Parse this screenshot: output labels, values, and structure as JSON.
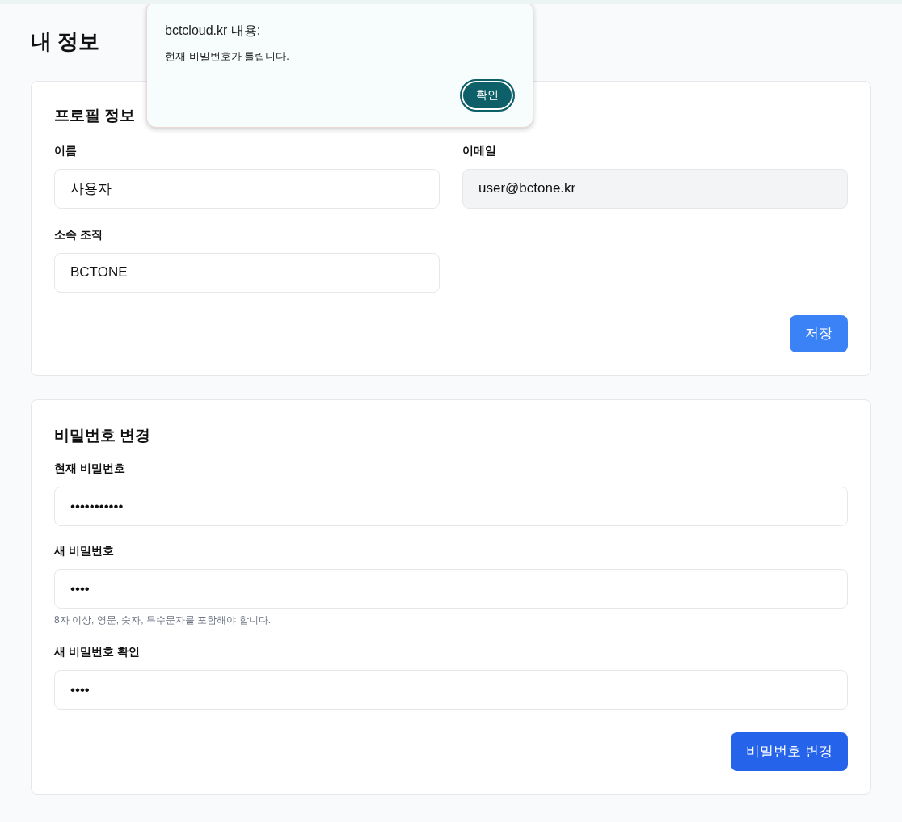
{
  "page_title": "내 정보",
  "profile": {
    "title": "프로필 정보",
    "fields": [
      {
        "label": "이름",
        "value": "사용자",
        "disabled": false
      },
      {
        "label": "이메일",
        "value": "user@bctone.kr",
        "disabled": true
      },
      {
        "label": "소속 조직",
        "value": "BCTONE",
        "disabled": false
      }
    ],
    "button": "저장"
  },
  "password": {
    "title": "비밀번호 변경",
    "fields": [
      {
        "label": "현재 비밀번호",
        "value": "•••••••••••"
      },
      {
        "label": "새 비밀번호",
        "value": "••••",
        "hint": "8자 이상, 영문, 숫자, 특수문자를 포함해야 합니다."
      },
      {
        "label": "새 비밀번호 확인",
        "value": "••••"
      }
    ],
    "button": "비밀번호 변경"
  },
  "dialog": {
    "title": "bctcloud.kr 내용:",
    "message": "현재 비밀번호가 틀립니다.",
    "button": "확인"
  }
}
